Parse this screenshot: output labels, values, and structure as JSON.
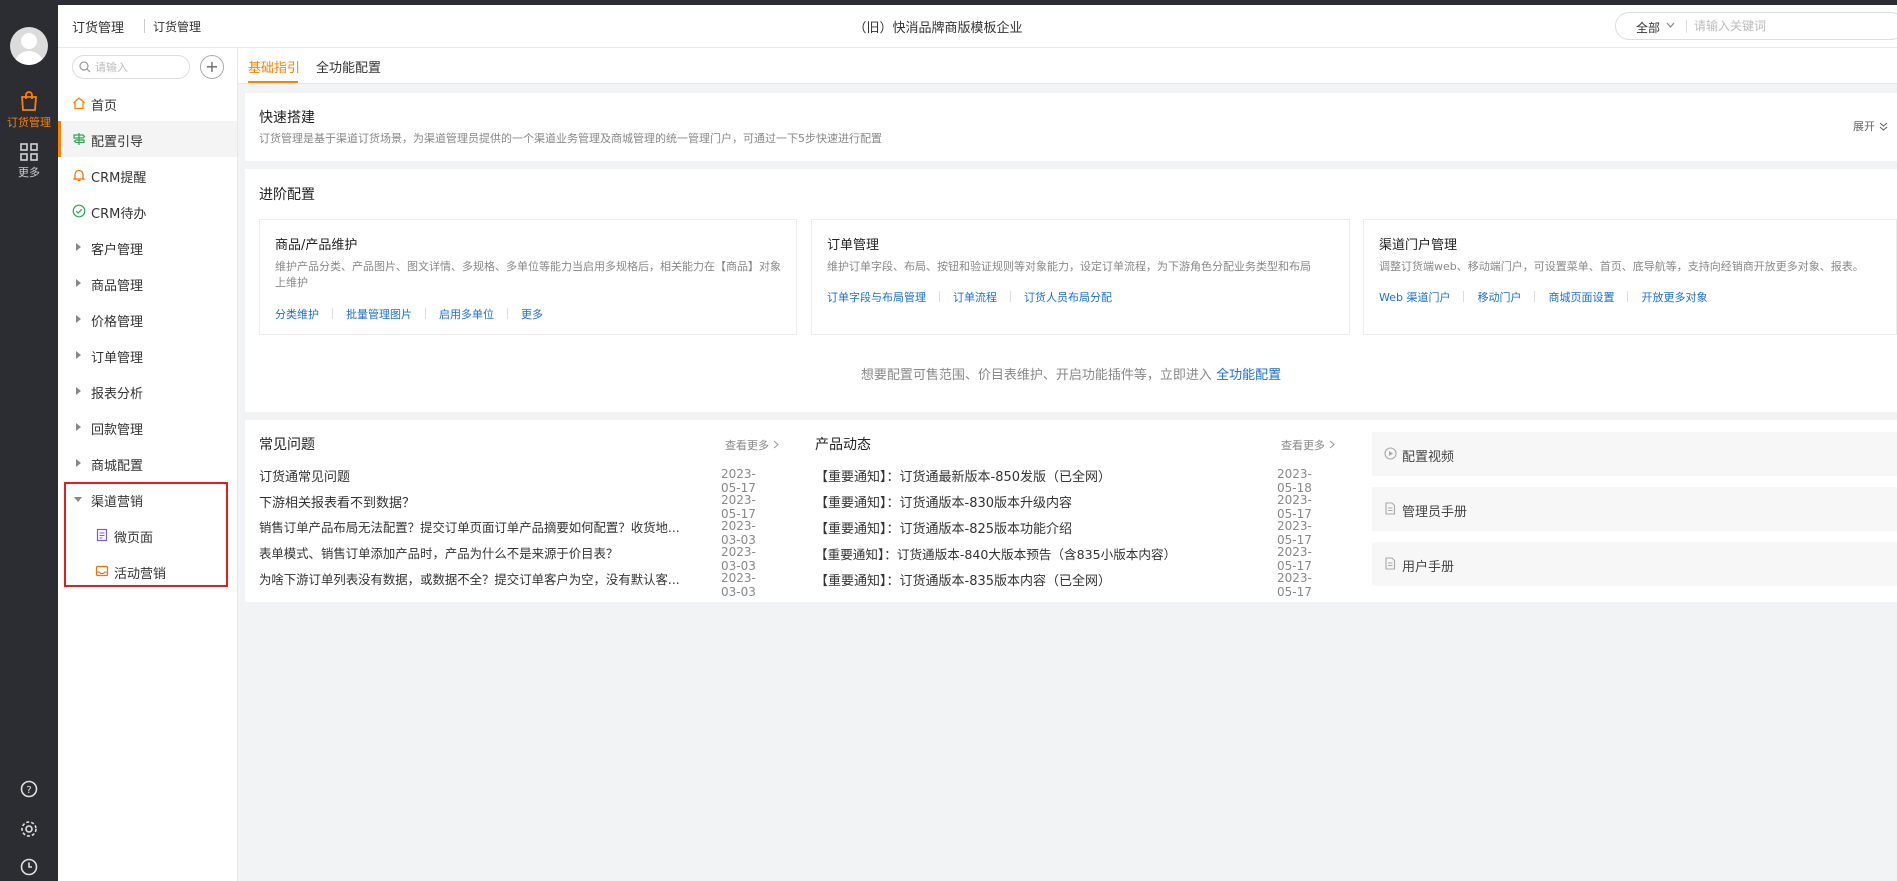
{
  "rail": {
    "items": [
      {
        "label": "订货管理",
        "icon": "shopping-bag-icon",
        "active": true
      },
      {
        "label": "更多",
        "icon": "grid-icon",
        "active": false
      }
    ],
    "bottom_icons": [
      "help-icon",
      "settings-icon",
      "clock-icon"
    ]
  },
  "header": {
    "crumb1": "订货管理",
    "crumb2": "订货管理",
    "company": "（旧）快消品牌商版模板企业",
    "search_scope": "全部",
    "search_placeholder": "请输入关键词"
  },
  "sidebar": {
    "search_placeholder": "请输入",
    "add_label": "+",
    "items": [
      {
        "label": "首页",
        "icon": "home-icon"
      },
      {
        "label": "配置引导",
        "icon": "signpost-icon"
      },
      {
        "label": "CRM提醒",
        "icon": "bell-icon"
      },
      {
        "label": "CRM待办",
        "icon": "check-circle-icon"
      },
      {
        "label": "客户管理"
      },
      {
        "label": "商品管理"
      },
      {
        "label": "价格管理"
      },
      {
        "label": "订单管理"
      },
      {
        "label": "报表分析"
      },
      {
        "label": "回款管理"
      },
      {
        "label": "商城配置"
      },
      {
        "label": "渠道营销"
      },
      {
        "label": "微页面",
        "icon": "page-icon"
      },
      {
        "label": "活动营销",
        "icon": "inbox-icon"
      }
    ]
  },
  "tabs": [
    "基础指引",
    "全功能配置"
  ],
  "quick": {
    "title": "快速搭建",
    "desc": "订货管理是基于渠道订货场景，为渠道管理员提供的一个渠道业务管理及商城管理的统一管理门户，可通过一下5步快速进行配置",
    "expand": "展开"
  },
  "advanced": {
    "title": "进阶配置",
    "cards": [
      {
        "title": "商品/产品维护",
        "desc1": "维护产品分类、产品图片、图文详情、多规格、多单位等能力当启用多规格后，相关能力在【商品】对象",
        "desc2": "上维护",
        "links": [
          "分类维护",
          "批量管理图片",
          "启用多单位",
          "更多"
        ]
      },
      {
        "title": "订单管理",
        "desc1": "维护订单字段、布局、按钮和验证规则等对象能力，设定订单流程，为下游角色分配业务类型和布局",
        "desc2": "",
        "links": [
          "订单字段与布局管理",
          "订单流程",
          "订货人员布局分配"
        ]
      },
      {
        "title": "渠道门户管理",
        "desc1": "调整订货端web、移动端门户，可设置菜单、首页、底导航等，支持向经销商开放更多对象、报表。",
        "desc2": "",
        "links": [
          "Web 渠道门户",
          "移动门户",
          "商城页面设置",
          "开放更多对象"
        ]
      }
    ],
    "hint_text": "想要配置可售范围、价目表维护、开启功能插件等，立即进入",
    "hint_link": "全功能配置"
  },
  "faq": {
    "title": "常见问题",
    "more": "查看更多",
    "rows": [
      {
        "text": "订货通常见问题",
        "date": "2023-05-17"
      },
      {
        "text": "下游相关报表看不到数据？",
        "date": "2023-05-17"
      },
      {
        "text": "销售订单产品布局无法配置？提交订单页面订单产品摘要如何配置？收货地...",
        "date": "2023-03-03"
      },
      {
        "text": "表单模式、销售订单添加产品时，产品为什么不是来源于价目表？",
        "date": "2023-03-03"
      },
      {
        "text": "为啥下游订单列表没有数据，或数据不全？提交订单客户为空，没有默认客...",
        "date": "2023-03-03"
      }
    ]
  },
  "news": {
    "title": "产品动态",
    "more": "查看更多",
    "rows": [
      {
        "text": "【重要通知】：订货通最新版本-850发版（已全网）",
        "date": "2023-05-18"
      },
      {
        "text": "【重要通知】：订货通版本-830版本升级内容",
        "date": "2023-05-17"
      },
      {
        "text": "【重要通知】：订货通版本-825版本功能介绍",
        "date": "2023-05-17"
      },
      {
        "text": "【重要通知】：订货通版本-840大版本预告（含835小版本内容）",
        "date": "2023-05-17"
      },
      {
        "text": "【重要通知】：订货通版本-835版本内容（已全网）",
        "date": "2023-05-17"
      }
    ]
  },
  "resources": [
    {
      "label": "配置视频",
      "icon": "play-icon"
    },
    {
      "label": "管理员手册",
      "icon": "document-icon"
    },
    {
      "label": "用户手册",
      "icon": "document-icon"
    }
  ],
  "colors": {
    "accent": "#ff8000",
    "link": "#1a6fd8",
    "rail": "#2b2d33",
    "highlight": "#e02020"
  }
}
